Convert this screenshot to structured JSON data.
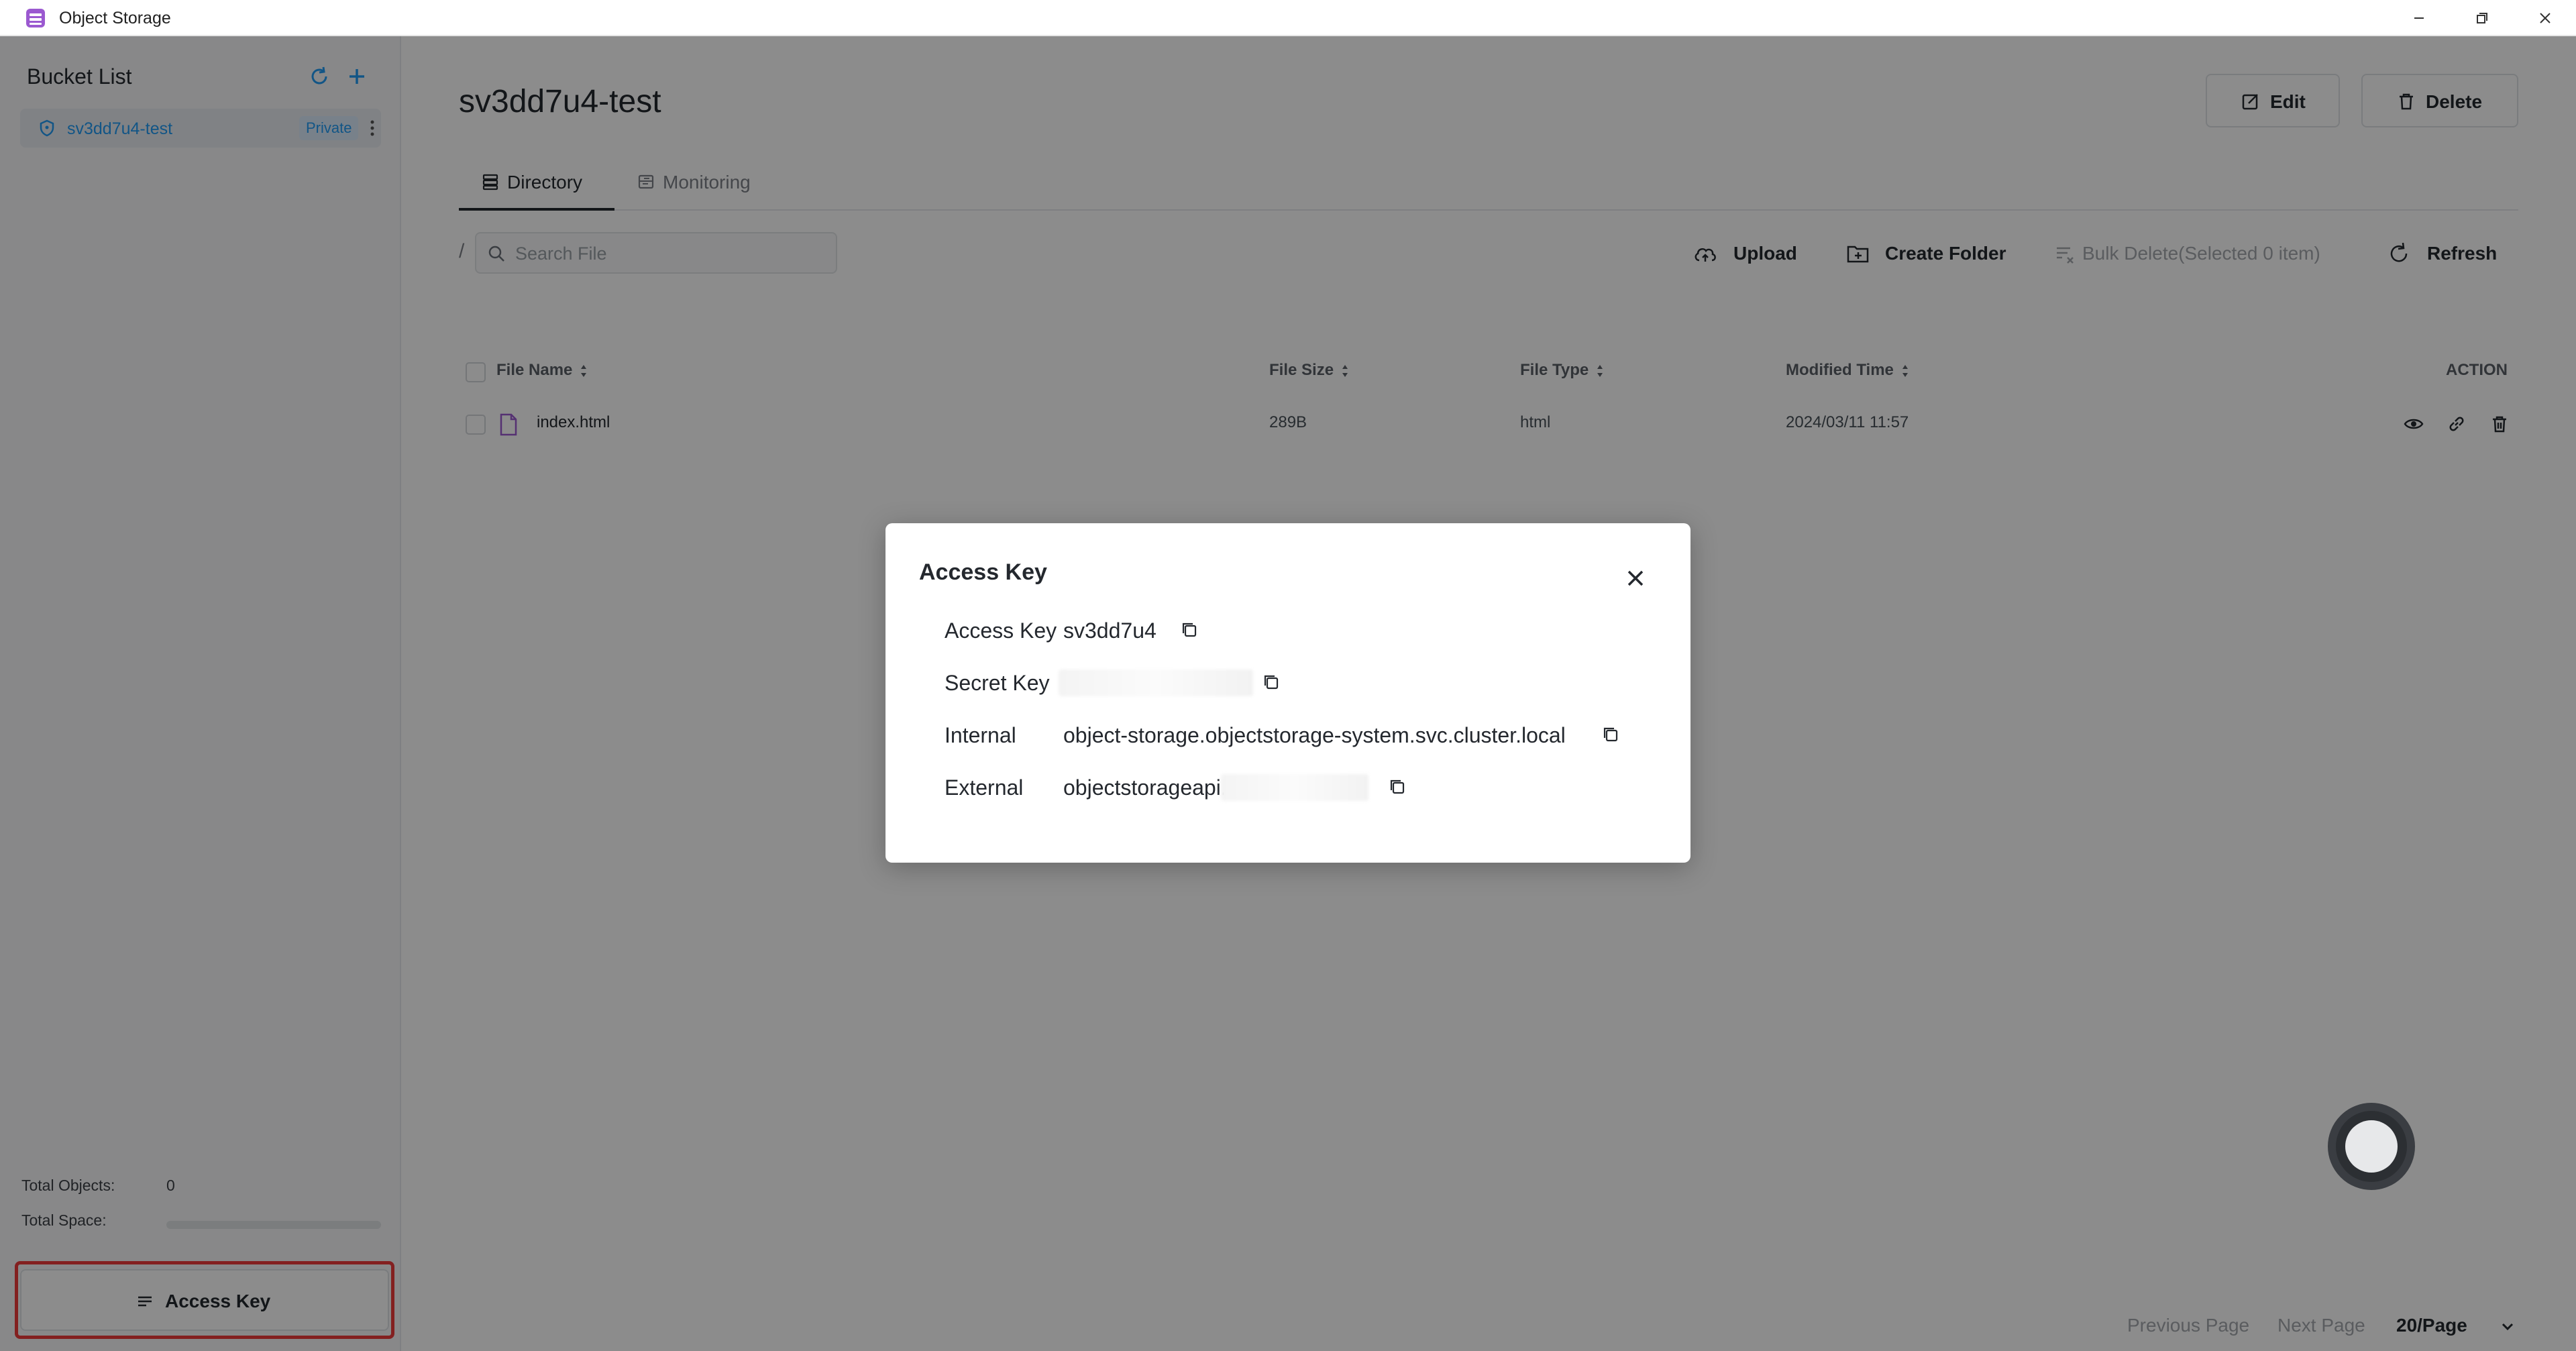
{
  "titlebar": {
    "title": "Object Storage"
  },
  "sidebar": {
    "heading": "Bucket List",
    "buckets": [
      {
        "name": "sv3dd7u4-test",
        "badge": "Private"
      }
    ],
    "stats": {
      "total_objects_label": "Total Objects:",
      "total_objects_value": "0",
      "total_space_label": "Total Space:",
      "total_space_fraction": 0
    },
    "access_key_button": "Access Key"
  },
  "main": {
    "title": "sv3dd7u4-test",
    "edit_label": "Edit",
    "delete_label": "Delete",
    "tabs": [
      {
        "label": "Directory"
      },
      {
        "label": "Monitoring"
      }
    ],
    "path": "/",
    "search_placeholder": "Search File",
    "toolbar": {
      "upload": "Upload",
      "create_folder": "Create Folder",
      "bulk_delete": "Bulk Delete(Selected 0 item)",
      "refresh": "Refresh"
    },
    "table": {
      "columns": [
        "File Name",
        "File Size",
        "File Type",
        "Modified Time",
        "ACTION"
      ],
      "rows": [
        {
          "name": "index.html",
          "size": "289B",
          "type": "html",
          "modified": "2024/03/11 11:57"
        }
      ]
    },
    "pagination": {
      "prev": "Previous Page",
      "next": "Next Page",
      "page_size": "20/Page"
    }
  },
  "modal": {
    "title": "Access Key",
    "rows": [
      {
        "key": "Access Key",
        "value": "sv3dd7u4"
      },
      {
        "key": "Secret Key",
        "value": ""
      },
      {
        "key": "Internal",
        "value": "object-storage.objectstorage-system.svc.cluster.local"
      },
      {
        "key": "External",
        "value": "objectstorageapi."
      }
    ]
  },
  "colors": {
    "accent": "#219bf4",
    "app_icon": "#9b59d0",
    "highlight": "#ef3b3b",
    "overlay": "rgba(0,0,0,0.45)"
  }
}
